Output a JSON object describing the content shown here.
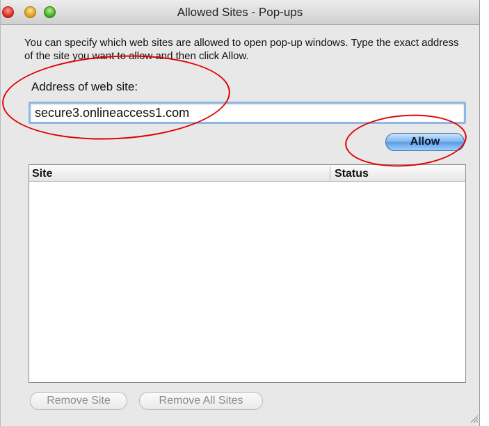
{
  "window": {
    "title": "Allowed Sites - Pop-ups",
    "controls": [
      "close",
      "minimize",
      "zoom"
    ]
  },
  "description": "You can specify which web sites are allowed to open pop-up windows. Type the exact address of the site you want to allow and then click Allow.",
  "address": {
    "label": "Address of web site:",
    "value": "secure3.onlineaccess1.com"
  },
  "allow_button": "Allow",
  "table": {
    "columns": [
      "Site",
      "Status"
    ],
    "rows": []
  },
  "buttons": {
    "remove_site": "Remove Site",
    "remove_all_sites": "Remove All Sites"
  },
  "colors": {
    "annotation": "#e00000",
    "focus_ring": "#8fb7e6",
    "allow_button": "#5b9be6"
  }
}
